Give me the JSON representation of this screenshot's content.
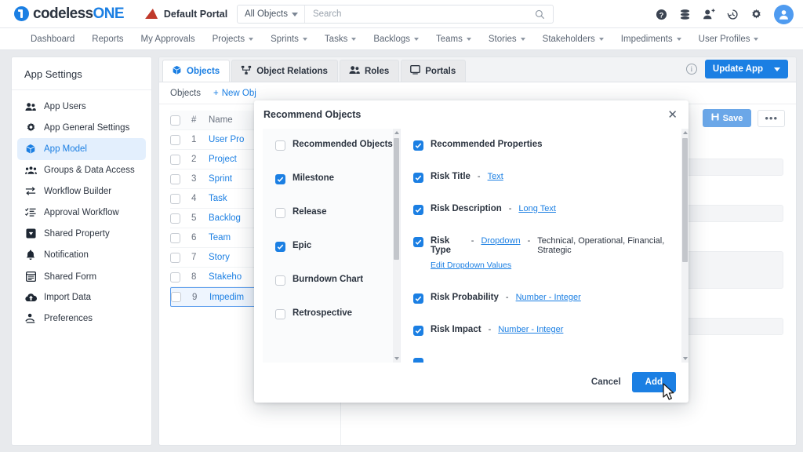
{
  "topbar": {
    "brand_dark": "codeless",
    "brand_blue": "ONE",
    "portal_label": "Default Portal",
    "search_scope": "All Objects",
    "search_placeholder": "Search",
    "search_value": "",
    "icons": [
      "help-icon",
      "database-icon",
      "add-user-icon",
      "history-icon",
      "gear-icon",
      "avatar"
    ]
  },
  "nav": {
    "items": [
      {
        "label": "Dashboard",
        "caret": false
      },
      {
        "label": "Reports",
        "caret": false
      },
      {
        "label": "My Approvals",
        "caret": false
      },
      {
        "label": "Projects",
        "caret": true
      },
      {
        "label": "Sprints",
        "caret": true
      },
      {
        "label": "Tasks",
        "caret": true
      },
      {
        "label": "Backlogs",
        "caret": true
      },
      {
        "label": "Teams",
        "caret": true
      },
      {
        "label": "Stories",
        "caret": true
      },
      {
        "label": "Stakeholders",
        "caret": true
      },
      {
        "label": "Impediments",
        "caret": true
      },
      {
        "label": "User Profiles",
        "caret": true
      }
    ]
  },
  "sidebar": {
    "title": "App Settings",
    "items": [
      {
        "label": "App Users",
        "icon": "users-icon",
        "active": false
      },
      {
        "label": "App General Settings",
        "icon": "gear-icon",
        "active": false
      },
      {
        "label": "App Model",
        "icon": "cube-icon",
        "active": true
      },
      {
        "label": "Groups & Data Access",
        "icon": "group-icon",
        "active": false
      },
      {
        "label": "Workflow Builder",
        "icon": "arrows-icon",
        "active": false
      },
      {
        "label": "Approval Workflow",
        "icon": "checklist-icon",
        "active": false
      },
      {
        "label": "Shared Property",
        "icon": "dropdown-box-icon",
        "active": false
      },
      {
        "label": "Notification",
        "icon": "bell-icon",
        "active": false
      },
      {
        "label": "Shared Form",
        "icon": "form-icon",
        "active": false
      },
      {
        "label": "Import Data",
        "icon": "cloud-upload-icon",
        "active": false
      },
      {
        "label": "Preferences",
        "icon": "preferences-icon",
        "active": false
      }
    ]
  },
  "content": {
    "tabs": [
      {
        "label": "Objects",
        "icon": "cube-icon",
        "active": true
      },
      {
        "label": "Object Relations",
        "icon": "relations-icon",
        "active": false
      },
      {
        "label": "Roles",
        "icon": "users-icon",
        "active": false
      },
      {
        "label": "Portals",
        "icon": "monitor-icon",
        "active": false
      }
    ],
    "update_app_label": "Update App",
    "toolbar": {
      "title": "Objects",
      "new_object_label": "New Obj"
    },
    "table": {
      "columns": [
        "#",
        "Name"
      ],
      "rows": [
        {
          "num": "1",
          "name": "User Pro",
          "selected": false
        },
        {
          "num": "2",
          "name": "Project",
          "selected": false
        },
        {
          "num": "3",
          "name": "Sprint",
          "selected": false
        },
        {
          "num": "4",
          "name": "Task",
          "selected": false
        },
        {
          "num": "5",
          "name": "Backlog",
          "selected": false
        },
        {
          "num": "6",
          "name": "Team",
          "selected": false
        },
        {
          "num": "7",
          "name": "Story",
          "selected": false
        },
        {
          "num": "8",
          "name": "Stakeho",
          "selected": false
        },
        {
          "num": "9",
          "name": "Impedim",
          "selected": true
        }
      ]
    },
    "save_label": "Save",
    "more_label": "•••"
  },
  "modal": {
    "title": "Recommend Objects",
    "left_header": {
      "label": "Recommended Objects",
      "checked": false
    },
    "objects": [
      {
        "label": "Milestone",
        "checked": true
      },
      {
        "label": "Release",
        "checked": false
      },
      {
        "label": "Epic",
        "checked": true
      },
      {
        "label": "Burndown Chart",
        "checked": false
      },
      {
        "label": "Retrospective",
        "checked": false
      }
    ],
    "right_header": {
      "label": "Recommended Properties",
      "checked": true
    },
    "properties": [
      {
        "label": "Risk Title",
        "checked": true,
        "type": "Text",
        "values": "",
        "edit_link": ""
      },
      {
        "label": "Risk Description",
        "checked": true,
        "type": "Long Text",
        "values": "",
        "edit_link": ""
      },
      {
        "label": "Risk Type",
        "checked": true,
        "type": "Dropdown",
        "values": "Technical, Operational, Financial, Strategic",
        "edit_link": "Edit Dropdown Values"
      },
      {
        "label": "Risk Probability",
        "checked": true,
        "type": "Number - Integer",
        "values": "",
        "edit_link": ""
      },
      {
        "label": "Risk Impact",
        "checked": true,
        "type": "Number - Integer",
        "values": "",
        "edit_link": ""
      }
    ],
    "cancel_label": "Cancel",
    "add_label": "Add"
  },
  "colors": {
    "accent": "#1b7fe3",
    "text": "#2c3440",
    "muted": "#6b7380",
    "bg": "#e8eaed"
  }
}
